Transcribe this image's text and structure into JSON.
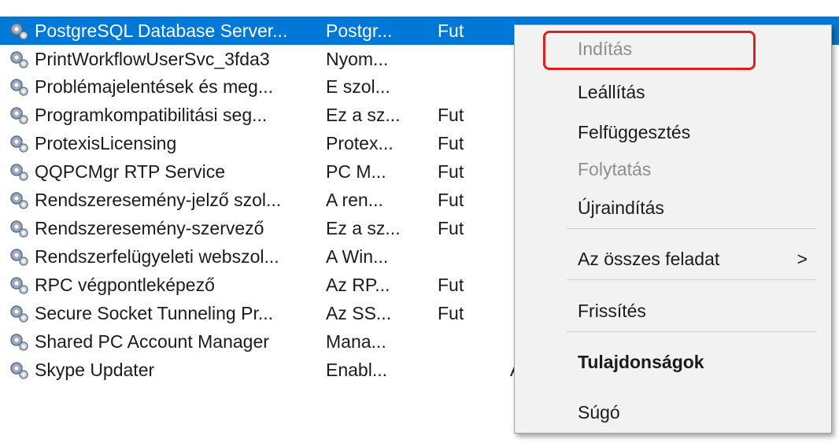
{
  "rows": [
    {
      "name": "PostgreSQL Database Server...",
      "desc": "Postgr...",
      "status": "Fut",
      "rest": "",
      "selected": true
    },
    {
      "name": "PrintWorkflowUserSvc_3fda3",
      "desc": "Nyom...",
      "status": "",
      "rest": ""
    },
    {
      "name": "Problémajelentések és meg...",
      "desc": "E szol...",
      "status": "",
      "rest": ""
    },
    {
      "name": "Programkompatibilitási seg...",
      "desc": "Ez a sz...",
      "status": "Fut",
      "rest": ""
    },
    {
      "name": "ProtexisLicensing",
      "desc": "Protex...",
      "status": "Fut",
      "rest": ""
    },
    {
      "name": "QQPCMgr RTP Service",
      "desc": "PC M...",
      "status": "Fut",
      "rest": ""
    },
    {
      "name": "Rendszeresemény-jelző szol...",
      "desc": "A ren...",
      "status": "Fut",
      "rest": ""
    },
    {
      "name": "Rendszeresemény-szervező",
      "desc": "Ez a sz...",
      "status": "Fut",
      "rest": ""
    },
    {
      "name": "Rendszerfelügyeleti webszol...",
      "desc": "A Win...",
      "status": "",
      "rest": ""
    },
    {
      "name": "RPC végpontleképező",
      "desc": "Az RP...",
      "status": "Fut",
      "rest": ""
    },
    {
      "name": "Secure Socket Tunneling Pr...",
      "desc": "Az SS...",
      "status": "Fut",
      "rest": ""
    },
    {
      "name": "Shared PC Account Manager",
      "desc": "Mana...",
      "status": "",
      "rest": ""
    },
    {
      "name": "Skype Updater",
      "desc": "Enabl...",
      "status": "",
      "rest": "Automatikus   Helyi rendszer"
    }
  ],
  "menu": {
    "items": [
      {
        "label": "Indítás",
        "disabled": true
      },
      {
        "label": "Leállítás"
      },
      {
        "label": "Felfüggesztés"
      },
      {
        "label": "Folytatás",
        "disabled": true
      },
      {
        "label": "Újraindítás"
      },
      {
        "label": "Az összes feladat",
        "submenu": true,
        "arrow": ">"
      },
      {
        "label": "Frissítés"
      },
      {
        "label": "Tulajdonságok",
        "bold": true
      },
      {
        "label": "Súgó"
      }
    ]
  },
  "colors": {
    "selection": "#0078d7",
    "highlight_border": "#e02020",
    "menu_background": "#f2f2f2",
    "disabled_text": "#8e8e8e"
  },
  "icons": {
    "service": "gear-icon"
  }
}
